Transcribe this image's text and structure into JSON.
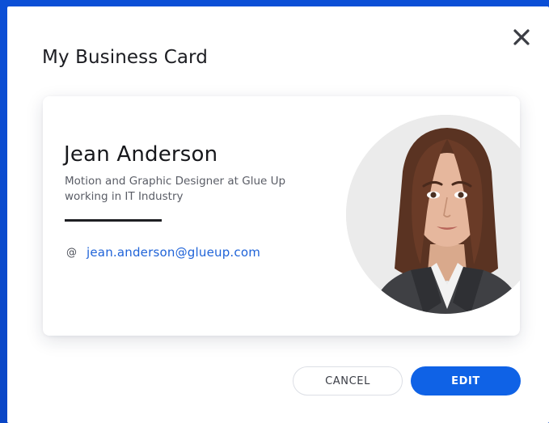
{
  "modal": {
    "title": "My Business Card",
    "close_icon": "close-icon"
  },
  "card": {
    "name": "Jean Anderson",
    "subtitle": "Motion and Graphic Designer at Glue Up working in IT Industry",
    "email_icon": "at-icon",
    "email_symbol": "@",
    "email": "jean.anderson@glueup.com",
    "avatar_icon": "avatar"
  },
  "actions": {
    "cancel_label": "CANCEL",
    "edit_label": "EDIT"
  },
  "colors": {
    "backdrop": "#0a49c9",
    "accent": "#0f62e6",
    "link": "#1f63d8",
    "title": "#1c1d22"
  }
}
